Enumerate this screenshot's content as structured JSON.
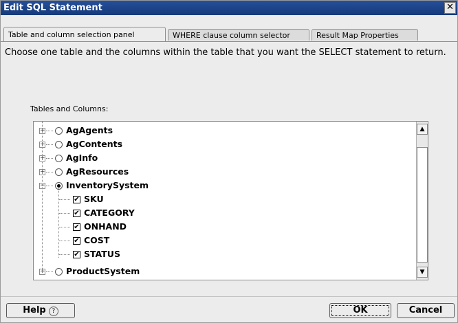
{
  "window": {
    "title": "Edit SQL Statement",
    "close_glyph": "✕"
  },
  "tabs": [
    {
      "label": "Table and column selection panel",
      "active": true
    },
    {
      "label": "WHERE clause column selector",
      "active": false
    },
    {
      "label": "Result Map Properties",
      "active": false
    }
  ],
  "panel": {
    "description": "Choose one table and the columns within the table that you want the SELECT statement to return.",
    "section_label": "Tables and Columns:"
  },
  "tree": {
    "items": [
      {
        "label": "AgAgents",
        "kind": "table",
        "expanded": false,
        "selected": false
      },
      {
        "label": "AgContents",
        "kind": "table",
        "expanded": false,
        "selected": false
      },
      {
        "label": "AgInfo",
        "kind": "table",
        "expanded": false,
        "selected": false
      },
      {
        "label": "AgResources",
        "kind": "table",
        "expanded": false,
        "selected": false
      },
      {
        "label": "InventorySystem",
        "kind": "table",
        "expanded": true,
        "selected": true
      },
      {
        "label": "SKU",
        "kind": "column",
        "checked": true
      },
      {
        "label": "CATEGORY",
        "kind": "column",
        "checked": true
      },
      {
        "label": "ONHAND",
        "kind": "column",
        "checked": true
      },
      {
        "label": "COST",
        "kind": "column",
        "checked": true
      },
      {
        "label": "STATUS",
        "kind": "column",
        "checked": true
      },
      {
        "label": "ProductSystem",
        "kind": "table",
        "expanded": false,
        "selected": false
      }
    ],
    "scroll_up_glyph": "▲",
    "scroll_down_glyph": "▼"
  },
  "buttons": {
    "help_label": "Help",
    "help_icon_glyph": "?",
    "ok_label": "OK",
    "cancel_label": "Cancel"
  },
  "icons": {
    "expand": "+",
    "collapse": "−",
    "check": "✔"
  }
}
